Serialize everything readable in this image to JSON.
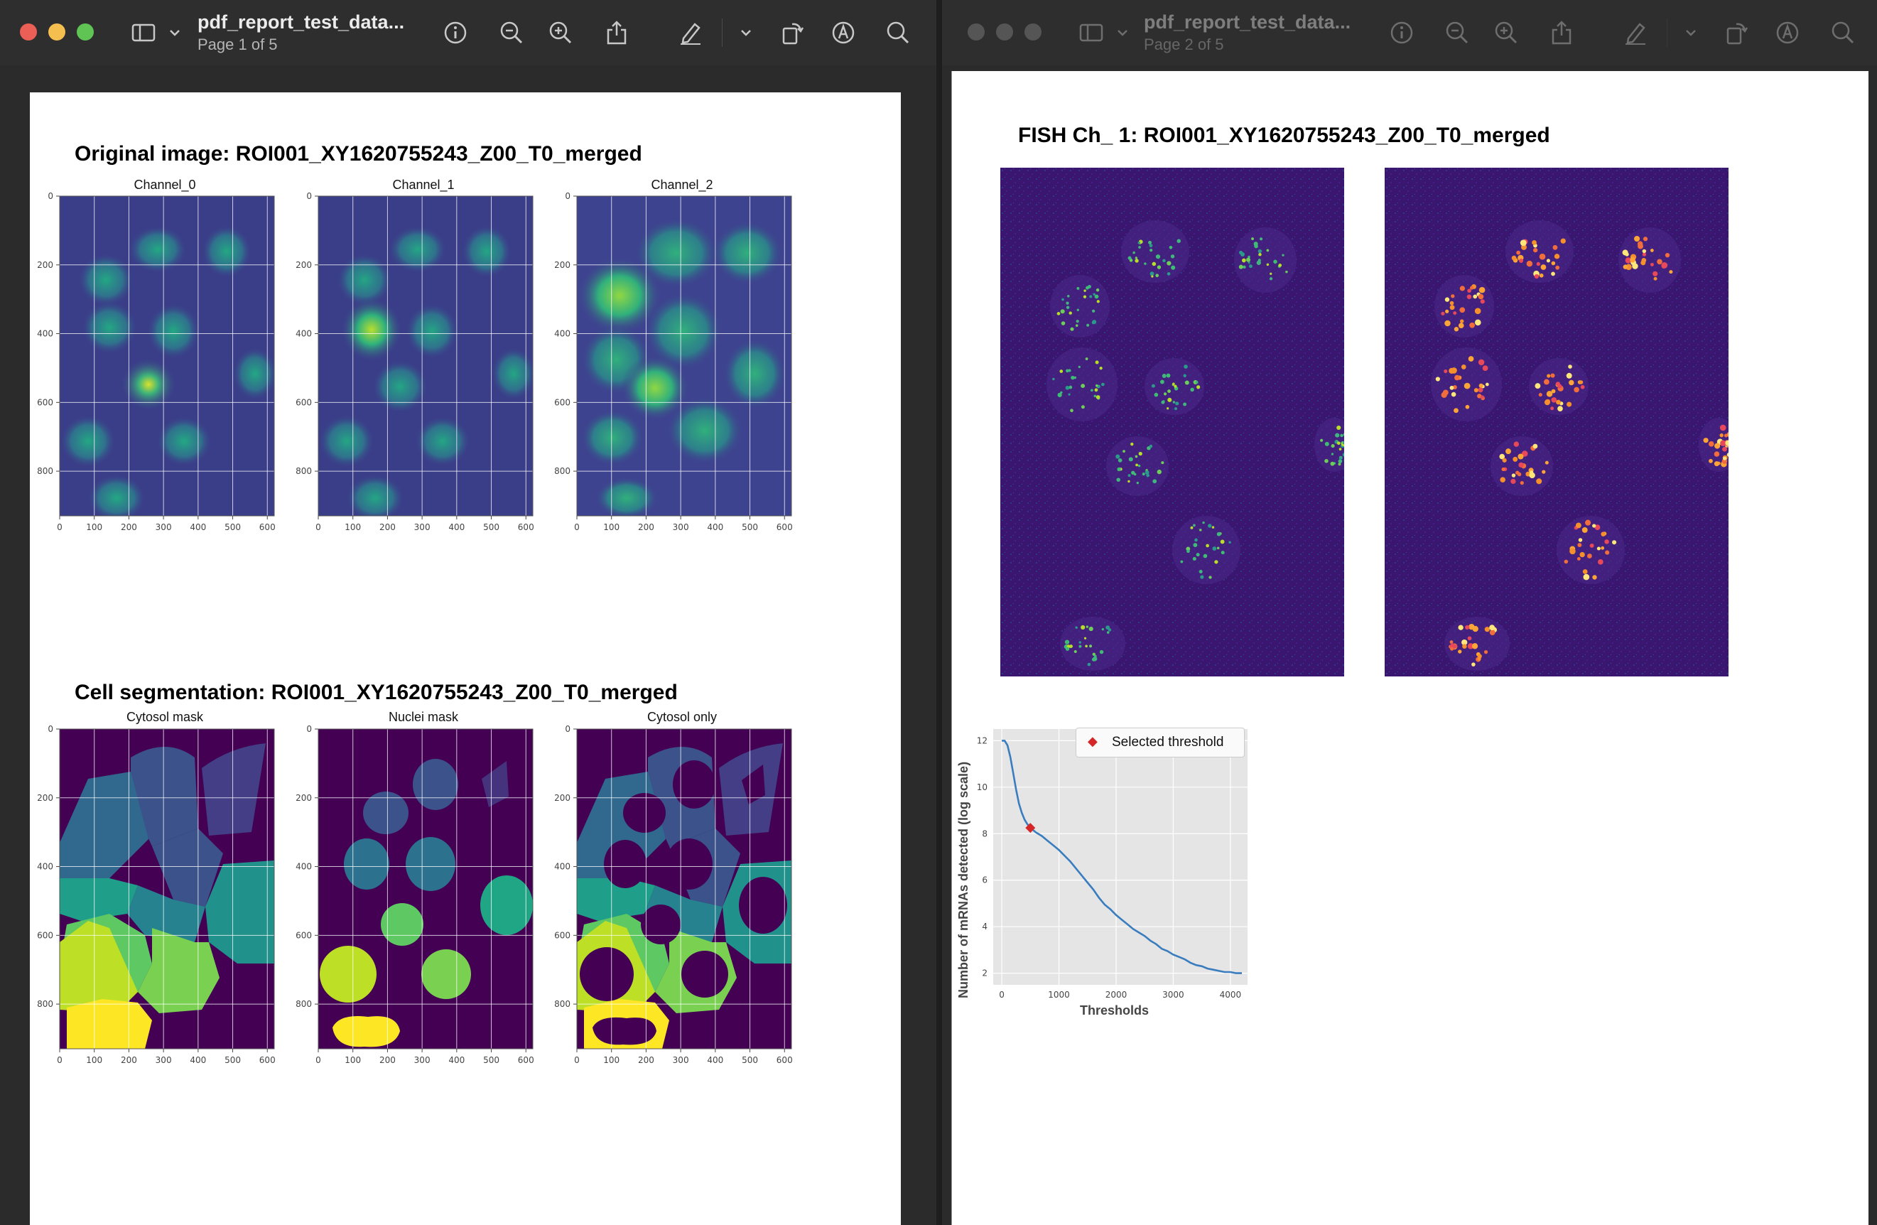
{
  "left_window": {
    "title": "pdf_report_test_data...",
    "page_indicator": "Page 1 of 5",
    "toolbar": [
      "sidebar-icon",
      "chevron-down-icon",
      "info-icon",
      "zoom-out-icon",
      "zoom-in-icon",
      "share-icon",
      "markup-pen-icon",
      "chevron-down-icon",
      "rotate-icon",
      "annotate-icon",
      "search-icon"
    ],
    "page": {
      "section1_title": "Original image: ROI001_XY1620755243_Z00_T0_merged",
      "section2_title": "Cell segmentation: ROI001_XY1620755243_Z00_T0_merged",
      "panels_row1": [
        "Channel_0",
        "Channel_1",
        "Channel_2"
      ],
      "panels_row2": [
        "Cytosol mask",
        "Nuclei mask",
        "Cytosol only"
      ],
      "x_ticks": [
        "0",
        "100",
        "200",
        "300",
        "400",
        "500",
        "600"
      ],
      "y_ticks": [
        "0",
        "200",
        "400",
        "600",
        "800"
      ]
    }
  },
  "right_window": {
    "title": "pdf_report_test_data...",
    "page_indicator": "Page 2 of 5",
    "toolbar": [
      "sidebar-icon",
      "chevron-down-icon",
      "info-icon",
      "zoom-out-icon",
      "zoom-in-icon",
      "share-icon",
      "markup-pen-icon",
      "chevron-down-icon",
      "rotate-icon",
      "annotate-icon",
      "search-icon"
    ],
    "page": {
      "fish_title": "FISH Ch_ 1: ROI001_XY1620755243_Z00_T0_merged"
    }
  },
  "colors": {
    "viridis_dark": "#440154",
    "viridis_blue": "#3b528b",
    "viridis_teal": "#21918c",
    "viridis_green": "#5ec962",
    "viridis_yellow": "#fde725",
    "line_blue": "#3a7dbf",
    "threshold_red": "#d62728"
  },
  "chart_data": {
    "type": "line",
    "xlabel": "Thresholds",
    "ylabel": "Number of mRNAs detected (log scale)",
    "x_ticks": [
      "0",
      "1000",
      "2000",
      "3000",
      "4000"
    ],
    "y_ticks": [
      "2",
      "4",
      "6",
      "8",
      "10",
      "12"
    ],
    "xlim": [
      -150,
      4300
    ],
    "ylim": [
      1.5,
      12.5
    ],
    "series": [
      {
        "x": [
          0,
          50,
          100,
          150,
          200,
          250,
          300,
          350,
          400,
          450,
          500,
          600,
          700,
          800,
          900,
          1000,
          1100,
          1200,
          1300,
          1400,
          1500,
          1600,
          1700,
          1800,
          1900,
          2000,
          2100,
          2200,
          2300,
          2400,
          2500,
          2600,
          2700,
          2800,
          2900,
          3000,
          3100,
          3200,
          3300,
          3400,
          3500,
          3600,
          3700,
          3800,
          3900,
          4000,
          4100,
          4200
        ],
        "y": [
          12.0,
          12.0,
          11.8,
          11.3,
          10.6,
          9.9,
          9.3,
          8.9,
          8.6,
          8.4,
          8.25,
          8.05,
          7.9,
          7.7,
          7.5,
          7.3,
          7.05,
          6.8,
          6.5,
          6.2,
          5.9,
          5.6,
          5.25,
          4.95,
          4.75,
          4.5,
          4.3,
          4.1,
          3.9,
          3.75,
          3.6,
          3.4,
          3.25,
          3.05,
          2.95,
          2.8,
          2.7,
          2.6,
          2.45,
          2.35,
          2.3,
          2.2,
          2.15,
          2.1,
          2.05,
          2.05,
          2.0,
          2.0
        ]
      }
    ],
    "selected_threshold": {
      "label": "Selected threshold",
      "x": 500,
      "y": 8.25
    },
    "legend_position": "top-right",
    "grid": true
  }
}
